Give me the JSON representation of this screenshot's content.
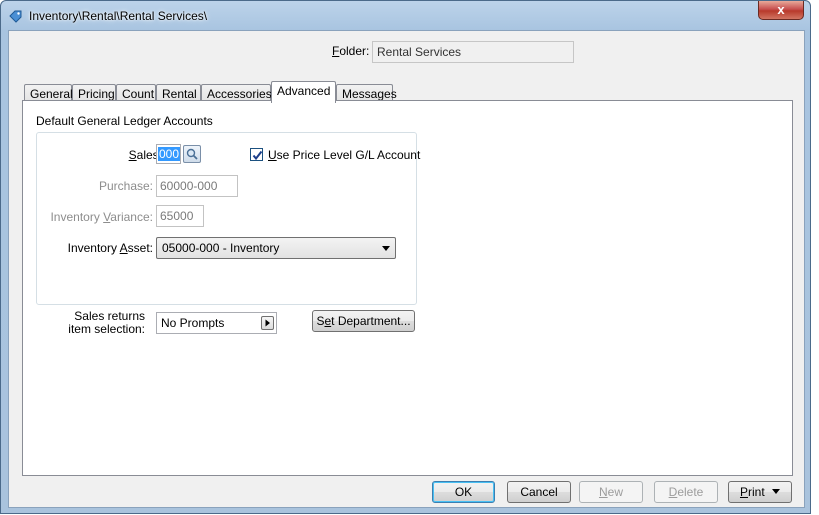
{
  "window": {
    "title": "Inventory\\Rental\\Rental Services\\",
    "close_glyph": "x"
  },
  "folder": {
    "label": "Folder:",
    "value": "Rental Services"
  },
  "tabs": [
    {
      "label": "General"
    },
    {
      "label": "Pricing"
    },
    {
      "label": "Count"
    },
    {
      "label": "Rental"
    },
    {
      "label": "Accessories"
    },
    {
      "label": "Advanced",
      "active": true
    },
    {
      "label": "Messages"
    }
  ],
  "advanced": {
    "group_title": "Default General Ledger Accounts",
    "sales": {
      "label": "Sales:",
      "value": "000"
    },
    "use_price_level": {
      "label": "Use Price Level G/L Account",
      "checked": true
    },
    "purchase": {
      "label": "Purchase:",
      "value": "60000-000"
    },
    "inventory_variance": {
      "label": "Inventory Variance:",
      "value": "65000"
    },
    "inventory_asset": {
      "label": "Inventory Asset:",
      "value": "05000-000 - Inventory"
    },
    "sales_returns": {
      "label_line1": "Sales returns",
      "label_line2": "item selection:",
      "value": "No Prompts"
    },
    "set_department_label": "Set Department..."
  },
  "buttons": {
    "ok": "OK",
    "cancel": "Cancel",
    "new": "New",
    "delete": "Delete",
    "print": "Print"
  },
  "colors": {
    "selection": "#3399ff",
    "default_button_border": "#3c7fb1"
  }
}
